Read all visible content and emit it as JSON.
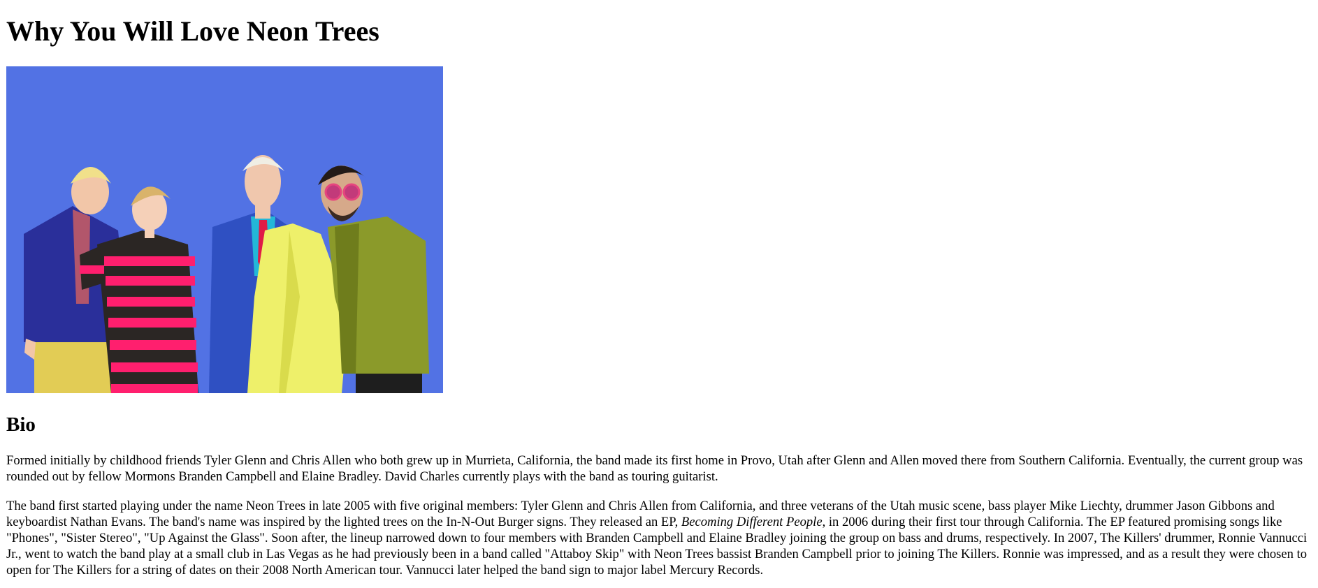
{
  "page_title": "Why You Will Love Neon Trees",
  "image": {
    "description_icon": "band-photo"
  },
  "bio": {
    "heading": "Bio",
    "paragraph_1": "Formed initially by childhood friends Tyler Glenn and Chris Allen who both grew up in Murrieta, California, the band made its first home in Provo, Utah after Glenn and Allen moved there from Southern California. Eventually, the current group was rounded out by fellow Mormons Branden Campbell and Elaine Bradley. David Charles currently plays with the band as touring guitarist.",
    "paragraph_2_before": "The band first started playing under the name Neon Trees in late 2005 with five original members: Tyler Glenn and Chris Allen from California, and three veterans of the Utah music scene, bass player Mike Liechty, drummer Jason Gibbons and keyboardist Nathan Evans. The band's name was inspired by the lighted trees on the In-N-Out Burger signs. They released an EP, ",
    "paragraph_2_em": "Becoming Different People",
    "paragraph_2_after": ", in 2006 during their first tour through California. The EP featured promising songs like \"Phones\", \"Sister Stereo\", \"Up Against the Glass\". Soon after, the lineup narrowed down to four members with Branden Campbell and Elaine Bradley joining the group on bass and drums, respectively. In 2007, The Killers' drummer, Ronnie Vannucci Jr., went to watch the band play at a small club in Las Vegas as he had previously been in a band called \"Attaboy Skip\" with Neon Trees bassist Branden Campbell prior to joining The Killers. Ronnie was impressed, and as a result they were chosen to open for The Killers for a string of dates on their 2008 North American tour. Vannucci later helped the band sign to major label Mercury Records."
  },
  "colors": {
    "sky": "#4d6be0",
    "navy_suit": "#2a2f9a",
    "pink_stripe": "#ff1f6e",
    "yellow_coat": "#eef06a",
    "olive_jacket": "#8b9a2a"
  }
}
